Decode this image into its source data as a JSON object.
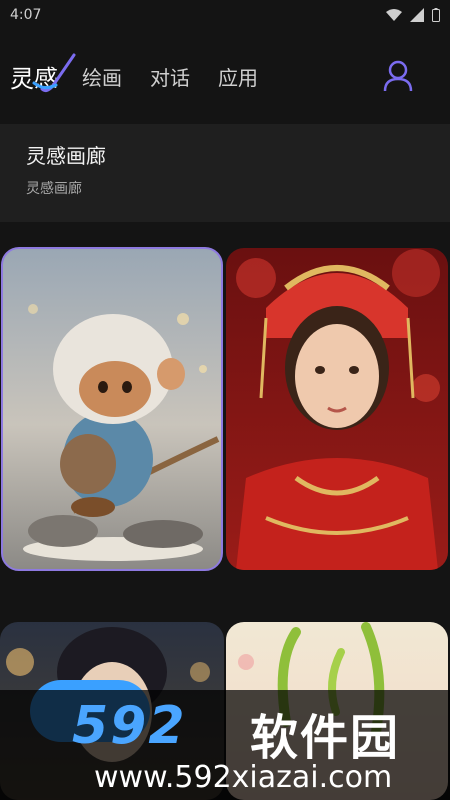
{
  "status_bar": {
    "time": "4:07",
    "icons": [
      "wifi-icon",
      "signal-icon",
      "battery-icon"
    ]
  },
  "nav": {
    "brand": "灵感",
    "tabs": [
      "绘画",
      "对话",
      "应用"
    ],
    "profile_icon": "user-icon",
    "accent_color": "#7b6cf0"
  },
  "gallery": {
    "title": "灵感画廊",
    "subtitle": "灵感画廊"
  },
  "tiles": [
    {
      "name": "monkey-tile",
      "selected": true
    },
    {
      "name": "girl-tile",
      "selected": false
    },
    {
      "name": "portrait-tile",
      "selected": false
    },
    {
      "name": "plant-tile",
      "selected": false
    }
  ],
  "watermark": {
    "logo": "592",
    "chinese": "软件园",
    "url": "www.592xiazai.com",
    "color": "#4aa5ff"
  }
}
